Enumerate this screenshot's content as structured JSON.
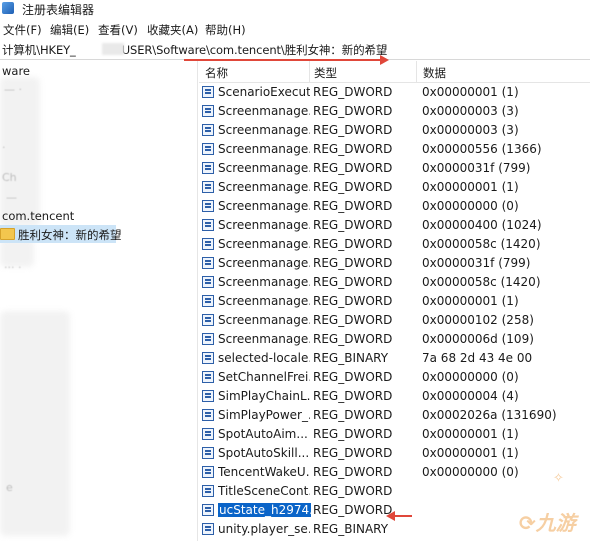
{
  "window": {
    "title": "注册表编辑器"
  },
  "menu": [
    "文件(F)",
    "编辑(E)",
    "查看(V)",
    "收藏夹(A)",
    "帮助(H)"
  ],
  "address": {
    "prefix": "计算机\\HKEY_",
    "suffix": "USER\\Software\\com.tencent\\胜利女神：新的希望"
  },
  "tree": {
    "items": [
      "ware",
      "com.tencent"
    ],
    "selected": "胜利女神：新的希望"
  },
  "columns": {
    "name": "名称",
    "type": "类型",
    "data": "数据"
  },
  "rows": [
    {
      "name": "ScenarioExecut...",
      "type": "REG_DWORD",
      "data": "0x00000001 (1)"
    },
    {
      "name": "Screenmanage...",
      "type": "REG_DWORD",
      "data": "0x00000003 (3)"
    },
    {
      "name": "Screenmanage...",
      "type": "REG_DWORD",
      "data": "0x00000003 (3)"
    },
    {
      "name": "Screenmanage...",
      "type": "REG_DWORD",
      "data": "0x00000556 (1366)"
    },
    {
      "name": "Screenmanage...",
      "type": "REG_DWORD",
      "data": "0x0000031f (799)"
    },
    {
      "name": "Screenmanage...",
      "type": "REG_DWORD",
      "data": "0x00000001 (1)"
    },
    {
      "name": "Screenmanage...",
      "type": "REG_DWORD",
      "data": "0x00000000 (0)"
    },
    {
      "name": "Screenmanage...",
      "type": "REG_DWORD",
      "data": "0x00000400 (1024)"
    },
    {
      "name": "Screenmanage...",
      "type": "REG_DWORD",
      "data": "0x0000058c (1420)"
    },
    {
      "name": "Screenmanage...",
      "type": "REG_DWORD",
      "data": "0x0000031f (799)"
    },
    {
      "name": "Screenmanage...",
      "type": "REG_DWORD",
      "data": "0x0000058c (1420)"
    },
    {
      "name": "Screenmanage...",
      "type": "REG_DWORD",
      "data": "0x00000001 (1)"
    },
    {
      "name": "Screenmanage...",
      "type": "REG_DWORD",
      "data": "0x00000102 (258)"
    },
    {
      "name": "Screenmanage...",
      "type": "REG_DWORD",
      "data": "0x0000006d (109)"
    },
    {
      "name": "selected-locale...",
      "type": "REG_BINARY",
      "data": "7a 68 2d 43 4e 00"
    },
    {
      "name": "SetChannelFrei...",
      "type": "REG_DWORD",
      "data": "0x00000000 (0)"
    },
    {
      "name": "SimPlayChainL...",
      "type": "REG_DWORD",
      "data": "0x00000004 (4)"
    },
    {
      "name": "SimPlayPower_...",
      "type": "REG_DWORD",
      "data": "0x0002026a (131690)"
    },
    {
      "name": "SpotAutoAim...",
      "type": "REG_DWORD",
      "data": "0x00000001 (1)"
    },
    {
      "name": "SpotAutoSkill...",
      "type": "REG_DWORD",
      "data": "0x00000001 (1)"
    },
    {
      "name": "TencentWakeU...",
      "type": "REG_DWORD",
      "data": "0x00000000 (0)"
    },
    {
      "name": "TitleSceneCont...",
      "type": "REG_DWORD",
      "data": ""
    },
    {
      "name": "ucState_h2974...",
      "type": "REG_DWORD",
      "data": "",
      "selected": true
    },
    {
      "name": "unity.player_se...",
      "type": "REG_BINARY",
      "data": ""
    }
  ],
  "watermark": "九游",
  "colors": {
    "accent": "#0a64c8",
    "annotation": "#e0473a",
    "watermark": "#f0a858"
  }
}
